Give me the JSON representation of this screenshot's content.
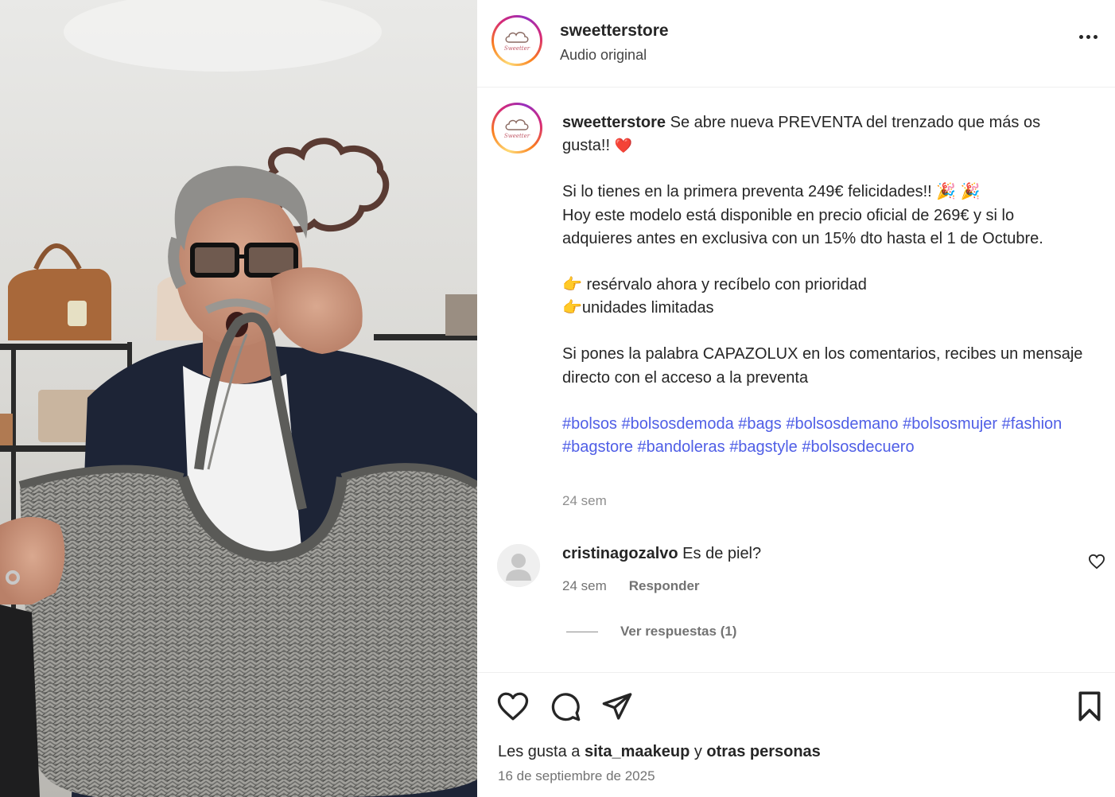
{
  "post": {
    "username": "sweetterstore",
    "subtitle": "Audio original",
    "avatar_brand": "Sweetter"
  },
  "caption": {
    "username": "sweetterstore",
    "intro": "Se abre nueva PREVENTA del trenzado que más os gusta!!",
    "intro_emoji": "❤️",
    "line1": "Si lo tienes en la primera preventa 249€ felicidades!!",
    "line1_emoji": "🎉 🎉",
    "line2": "Hoy este modelo está disponible en precio oficial de 269€ y si lo adquieres antes en exclusiva con un 15% dto hasta el 1 de Octubre.",
    "bullet1_emoji": "👉",
    "bullet1": "resérvalo ahora y recíbelo con prioridad",
    "bullet2_emoji": "👉",
    "bullet2": "unidades limitadas",
    "cta": "Si pones la palabra CAPAZOLUX en los comentarios, recibes un mensaje directo con el acceso a la preventa",
    "hashtags": [
      "#bolsos",
      "#bolsosdemoda",
      "#bags",
      "#bolsosdemano",
      "#bolsosmujer",
      "#fashion",
      "#bagstore",
      "#bandoleras",
      "#bagstyle",
      "#bolsosdecuero"
    ],
    "time": "24 sem"
  },
  "comment": {
    "username": "cristinagozalvo",
    "text": "Es de piel?",
    "time": "24 sem",
    "reply_label": "Responder",
    "view_replies": "Ver respuestas (1)"
  },
  "footer": {
    "likes_prefix": "Les gusta a",
    "likes_user": "sita_maakeup",
    "likes_joiner": "y",
    "likes_others": "otras personas",
    "date": "16 de septiembre de 2025"
  },
  "icons": {
    "more": "more-horizontal-icon",
    "like": "heart-icon",
    "comment": "comment-icon",
    "share": "share-icon",
    "save": "bookmark-icon"
  },
  "colors": {
    "hashtag": "#4f5ee6",
    "brand_pink": "#c4606e"
  }
}
